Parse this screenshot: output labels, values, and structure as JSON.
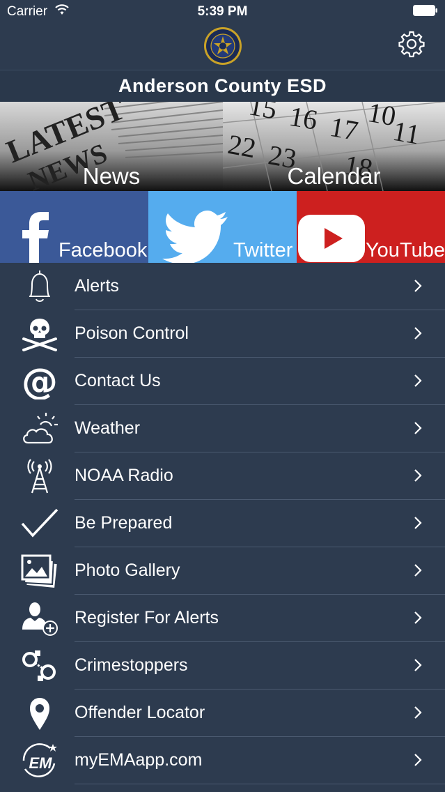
{
  "status_bar": {
    "carrier": "Carrier",
    "time": "5:39 PM"
  },
  "header": {
    "title": "Anderson County ESD"
  },
  "tiles": {
    "news": "News",
    "calendar": "Calendar",
    "facebook": "Facebook",
    "twitter": "Twitter",
    "youtube": "YouTube"
  },
  "colors": {
    "background": "#2d3b4f",
    "facebook": "#3b5998",
    "twitter": "#55acee",
    "youtube": "#cd201f"
  },
  "menu": [
    {
      "label": "Alerts",
      "icon": "bell-icon"
    },
    {
      "label": "Poison Control",
      "icon": "skull-crossbones-icon"
    },
    {
      "label": "Contact Us",
      "icon": "at-sign-icon"
    },
    {
      "label": "Weather",
      "icon": "cloud-sun-icon"
    },
    {
      "label": "NOAA Radio",
      "icon": "radio-tower-icon"
    },
    {
      "label": "Be Prepared",
      "icon": "checkmark-icon"
    },
    {
      "label": "Photo Gallery",
      "icon": "photos-icon"
    },
    {
      "label": "Register For Alerts",
      "icon": "add-user-icon"
    },
    {
      "label": "Crimestoppers",
      "icon": "handcuffs-icon"
    },
    {
      "label": "Offender Locator",
      "icon": "location-pin-icon"
    },
    {
      "label": "myEMAapp.com",
      "icon": "em-logo-icon"
    }
  ]
}
